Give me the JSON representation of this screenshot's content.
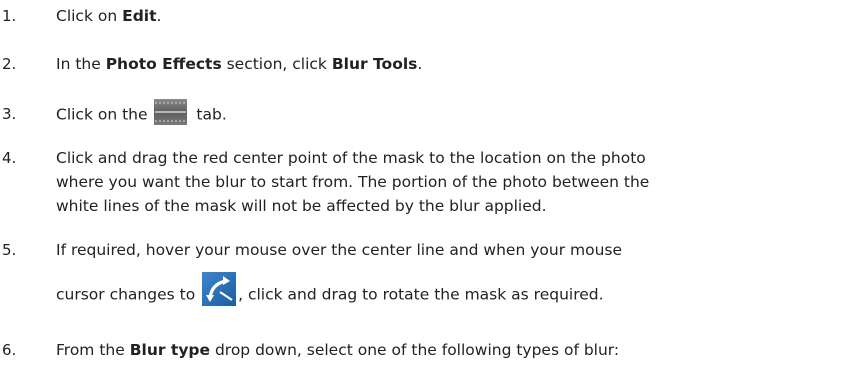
{
  "steps": [
    {
      "num": "1.",
      "pre": "Click on ",
      "bold": "Edit",
      "post": "."
    },
    {
      "num": "2.",
      "pre": "In the ",
      "bold1": "Photo Effects",
      "mid": " section, click ",
      "bold2": "Blur Tools",
      "post": "."
    },
    {
      "num": "3.",
      "pre": "Click on the",
      "post": "tab.",
      "icon": "linear-blur-tab-icon"
    },
    {
      "num": "4.",
      "lines": [
        "Click and drag the red center point of the mask to the location on the photo",
        "where you want the blur to start from. The portion of the photo between the",
        "white lines of the mask will not be affected by the blur applied."
      ]
    },
    {
      "num": "5.",
      "line1": "If required, hover your mouse over the center line and when your mouse",
      "line2_pre": "cursor changes to",
      "line2_post": ", click and drag to rotate the mask as required.",
      "icon": "rotate-cursor-icon"
    },
    {
      "num": "6.",
      "pre": "From the ",
      "bold": "Blur type",
      "post": " drop down, select one of the following types of blur:"
    }
  ],
  "colors": {
    "text": "#222222",
    "icon_blue": "#2a6fb0",
    "icon_gray": "#6e6e6e"
  }
}
